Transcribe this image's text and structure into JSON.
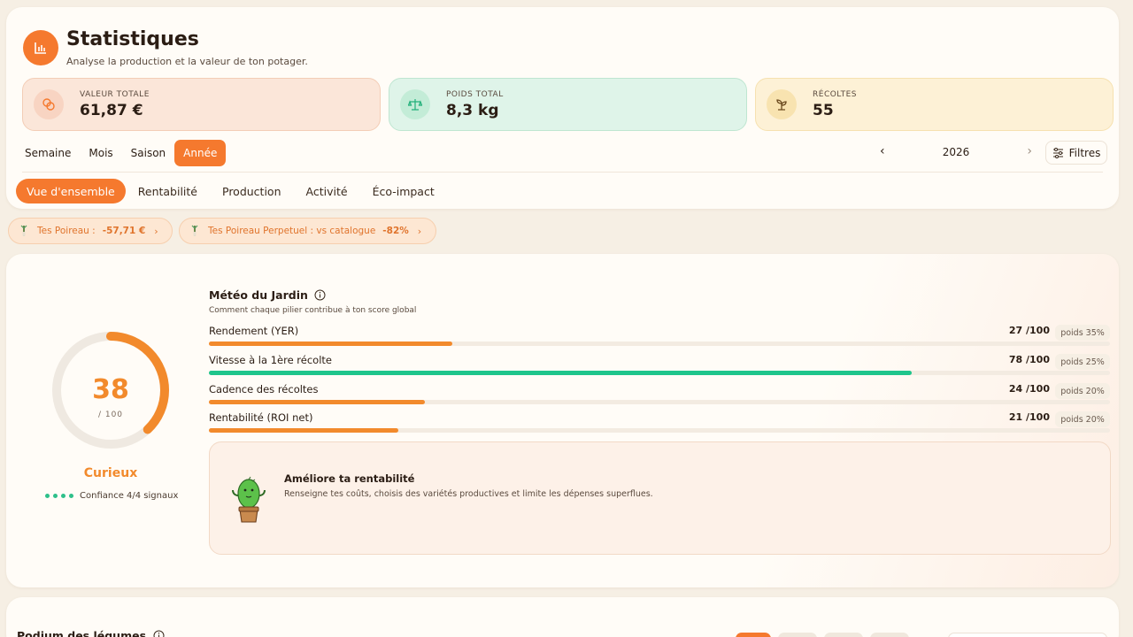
{
  "header": {
    "title": "Statistiques",
    "subtitle": "Analyse la production et la valeur de ton potager.",
    "logo_icon": "bar-chart-icon"
  },
  "kpis": [
    {
      "label": "VALEUR TOTALE",
      "value": "61,87 €",
      "icon": "coins-icon",
      "color": "#f5792e"
    },
    {
      "label": "POIDS TOTAL",
      "value": "8,3 kg",
      "icon": "scale-icon",
      "color": "#22b07a"
    },
    {
      "label": "RÉCOLTES",
      "value": "55",
      "icon": "sprout-icon",
      "color": "#6b4a1e"
    }
  ],
  "period_tabs": [
    {
      "label": "Semaine",
      "active": false
    },
    {
      "label": "Mois",
      "active": false
    },
    {
      "label": "Saison",
      "active": false
    },
    {
      "label": "Année",
      "active": true
    }
  ],
  "year_nav": {
    "year": "2026",
    "prev": "‹",
    "next": "›"
  },
  "filters_label": "Filtres",
  "main_tabs": [
    {
      "label": "Vue d'ensemble",
      "active": true
    },
    {
      "label": "Rentabilité",
      "active": false
    },
    {
      "label": "Production",
      "active": false
    },
    {
      "label": "Activité",
      "active": false
    },
    {
      "label": "Éco-impact",
      "active": false
    }
  ],
  "insight_chips": [
    {
      "text": "Tes Poireau :",
      "value": "-57,71 €"
    },
    {
      "text": "Tes Poireau Perpetuel : vs catalogue",
      "value": "-82%"
    }
  ],
  "score": {
    "value": "38",
    "max_label": "/ 100",
    "progress": 0.38,
    "level": "Curieux",
    "confidence": "Confiance 4/4 signaux",
    "confidence_dots": 4
  },
  "meteo": {
    "title": "Météo du Jardin",
    "subtitle": "Comment chaque pilier contribue à ton score global",
    "pillars": [
      {
        "label": "Rendement (YER)",
        "score": "27 /100",
        "weight": "poids 35%",
        "value": 27,
        "color": "#f28a2c"
      },
      {
        "label": "Vitesse à la 1ère récolte",
        "score": "78 /100",
        "weight": "poids 25%",
        "value": 78,
        "color": "#1fc58c"
      },
      {
        "label": "Cadence des récoltes",
        "score": "24 /100",
        "weight": "poids 20%",
        "value": 24,
        "color": "#f28a2c"
      },
      {
        "label": "Rentabilité (ROI net)",
        "score": "21 /100",
        "weight": "poids 20%",
        "value": 21,
        "color": "#f28a2c"
      }
    ]
  },
  "tip": {
    "title": "Améliore ta rentabilité",
    "text": "Renseigne tes coûts, choisis des variétés productives et limite les dépenses superflues."
  },
  "podium": {
    "title": "Podium des légumes"
  },
  "colors": {
    "accent": "#f5792e",
    "green": "#1fc58c",
    "orange": "#f28a2c"
  }
}
